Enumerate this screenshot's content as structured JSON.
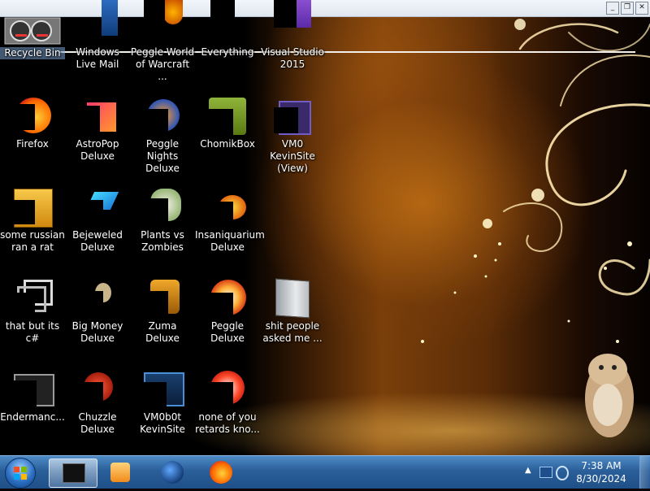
{
  "window": {
    "controls": [
      "minimize",
      "restore",
      "close"
    ]
  },
  "desktop": {
    "icons": [
      {
        "label": "Recycle Bin",
        "icon": "recycle-bin-icon",
        "selected": true
      },
      {
        "label": "Windows Live Mail",
        "icon": "mail-icon"
      },
      {
        "label": "Peggle World of Warcraft ...",
        "icon": "peggle-icon"
      },
      {
        "label": "Everything",
        "icon": "search-app-icon"
      },
      {
        "label": "Visual Studio 2015",
        "icon": "visual-studio-icon"
      },
      {
        "label": "Firefox",
        "icon": "firefox-icon"
      },
      {
        "label": "AstroPop Deluxe",
        "icon": "astropop-icon"
      },
      {
        "label": "Peggle Nights Deluxe",
        "icon": "peggle-nights-icon"
      },
      {
        "label": "ChomikBox",
        "icon": "chomikbox-icon"
      },
      {
        "label": "VM0 KevinSite (View)",
        "icon": "vm-icon"
      },
      {
        "label": "some russian ran a rat",
        "icon": "shortcut-file-icon"
      },
      {
        "label": "Bejeweled Deluxe",
        "icon": "bejeweled-icon"
      },
      {
        "label": "Plants vs Zombies",
        "icon": "plants-icon"
      },
      {
        "label": "Insaniquarium Deluxe",
        "icon": "fish-icon"
      },
      {
        "label": "that but its c#",
        "icon": "windows-stack-icon"
      },
      {
        "label": "Big Money Deluxe",
        "icon": "money-icon"
      },
      {
        "label": "Zuma Deluxe",
        "icon": "zuma-icon"
      },
      {
        "label": "Peggle Deluxe",
        "icon": "peggle-deluxe-icon"
      },
      {
        "label": "shit people asked me ...",
        "icon": "folder-icon"
      },
      {
        "label": "Endermanc...",
        "icon": "terminal-icon"
      },
      {
        "label": "Chuzzle Deluxe",
        "icon": "chuzzle-icon"
      },
      {
        "label": "VM0b0t KevinSite",
        "icon": "vm-bot-icon"
      },
      {
        "label": "none of you retards kno...",
        "icon": "app-icon"
      }
    ]
  },
  "taskbar": {
    "buttons": [
      {
        "name": "taskbar-app-terminal",
        "icon": "black-window-icon",
        "active": true
      },
      {
        "name": "taskbar-app-media-player",
        "icon": "media-player-icon"
      },
      {
        "name": "taskbar-app-globe",
        "icon": "globe-icon"
      },
      {
        "name": "taskbar-app-firefox",
        "icon": "firefox-icon"
      }
    ],
    "tray": {
      "time": "7:38 AM",
      "date": "8/30/2024"
    }
  },
  "colors": {
    "taskbar": "#2a5f99",
    "wallpaper_glow": "#c87a1a",
    "redaction": "#000000"
  }
}
